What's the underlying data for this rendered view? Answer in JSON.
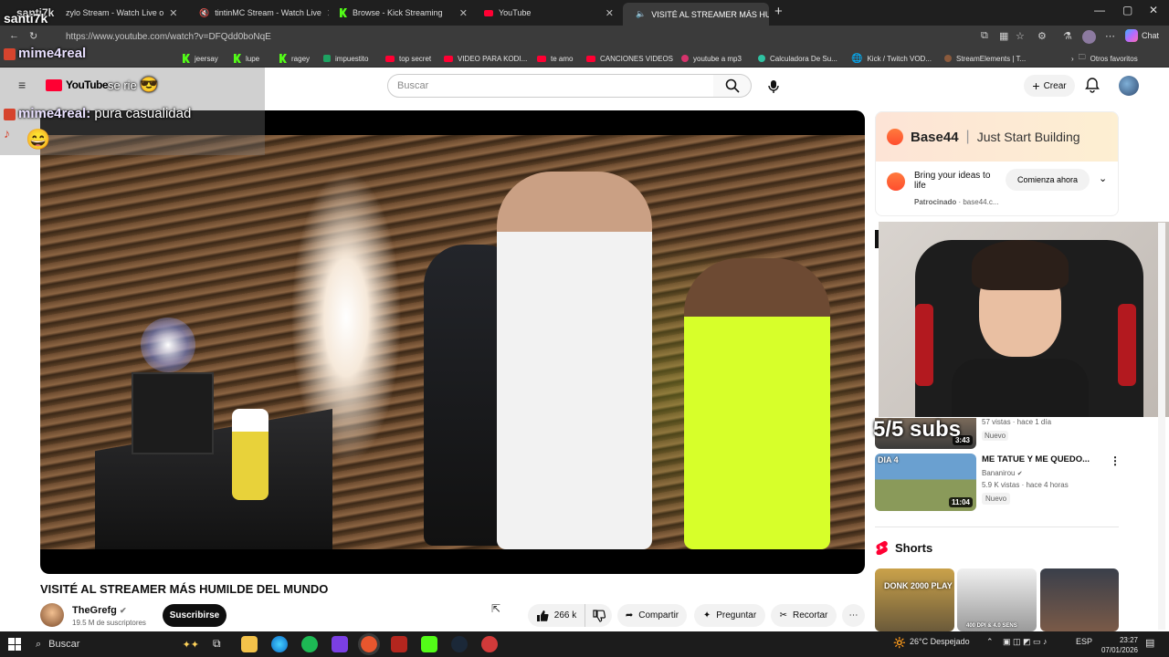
{
  "tabs": [
    {
      "label": "santi7k",
      "icon": "kick"
    },
    {
      "label": "zylo Stream - Watch Live o",
      "icon": "kick"
    },
    {
      "label": "tintinMC Stream - Watch Live",
      "icon": "kick"
    },
    {
      "label": "Browse - Kick Streaming",
      "icon": "kick"
    },
    {
      "label": "YouTube",
      "icon": "youtube"
    },
    {
      "label": "VISITÉ AL STREAMER MÁS HU",
      "icon": "youtube",
      "active": true
    }
  ],
  "address": {
    "url": "https://www.youtube.com/watch?v=DFQdd0boNqE",
    "chat_label": "Chat"
  },
  "bookmarks": [
    {
      "label": "jeersay",
      "color": "#53fc18"
    },
    {
      "label": "lupe",
      "color": "#53fc18"
    },
    {
      "label": "ragey",
      "color": "#53fc18"
    },
    {
      "label": "impuestito",
      "color": "#1ea362"
    },
    {
      "label": "top secret",
      "color": "#ff0033"
    },
    {
      "label": "VIDEO PARA KODI...",
      "color": "#ff0033"
    },
    {
      "label": "te amo",
      "color": "#ff0033"
    },
    {
      "label": "CANCIONES VIDEOS",
      "color": "#ff0033"
    },
    {
      "label": "youtube a mp3",
      "color": "#d6336c"
    },
    {
      "label": "Calculadora De Su...",
      "color": "#2fc2a2"
    },
    {
      "label": "Kick / Twitch VOD...",
      "color": "#bbbbbb"
    },
    {
      "label": "StreamElements | T...",
      "color": "#8b5a3c"
    }
  ],
  "bookmarks_other": "Otros favoritos",
  "chat_overlay": [
    {
      "user": "santi7k",
      "message": ""
    },
    {
      "user": "mime4real",
      "message": ""
    },
    {
      "user": "",
      "message": "se rie"
    },
    {
      "user": "mime4real:",
      "message": "pura casualidad"
    }
  ],
  "youtube": {
    "logo": "YouTube",
    "search_placeholder": "Buscar",
    "create_label": "Crear"
  },
  "video": {
    "title": "VISITÉ AL STREAMER MÁS HUMILDE DEL MUNDO",
    "channel": "TheGrefg",
    "subscribers": "19.5 M de suscriptores",
    "subscribe_label": "Suscribirse",
    "likes": "266 k",
    "share_label": "Compartir",
    "ask_label": "Preguntar",
    "clip_label": "Recortar"
  },
  "ad": {
    "brand": "Base44",
    "tagline": "Just Start Building",
    "text": "Bring your ideas to life",
    "cta": "Comienza ahora",
    "sponsored": "Patrocinado",
    "domain": "base44.c..."
  },
  "overlay_subs": "5/5 subs",
  "recommendation_partial": {
    "meta": "57 vistas · hace 1 día",
    "badge": "Nuevo",
    "duration": "3:43"
  },
  "recommendation": {
    "title": "ME TATUE Y ME QUEDO...",
    "channel": "Bananirou",
    "meta": "5.9 K vistas · hace 4 horas",
    "badge": "Nuevo",
    "duration": "11:04",
    "thumb_label": "DIA 4"
  },
  "shorts_title": "Shorts",
  "shorts": [
    {
      "label": "DONK 2000 PLAY"
    },
    {
      "label": "400 DPI & 4.0 SENS"
    },
    {
      "label": ""
    }
  ],
  "taskbar": {
    "search": "Buscar",
    "weather": "26°C",
    "weather_desc": "Despejado",
    "lang": "ESP",
    "time": "23:27",
    "date": "07/01/2026"
  }
}
